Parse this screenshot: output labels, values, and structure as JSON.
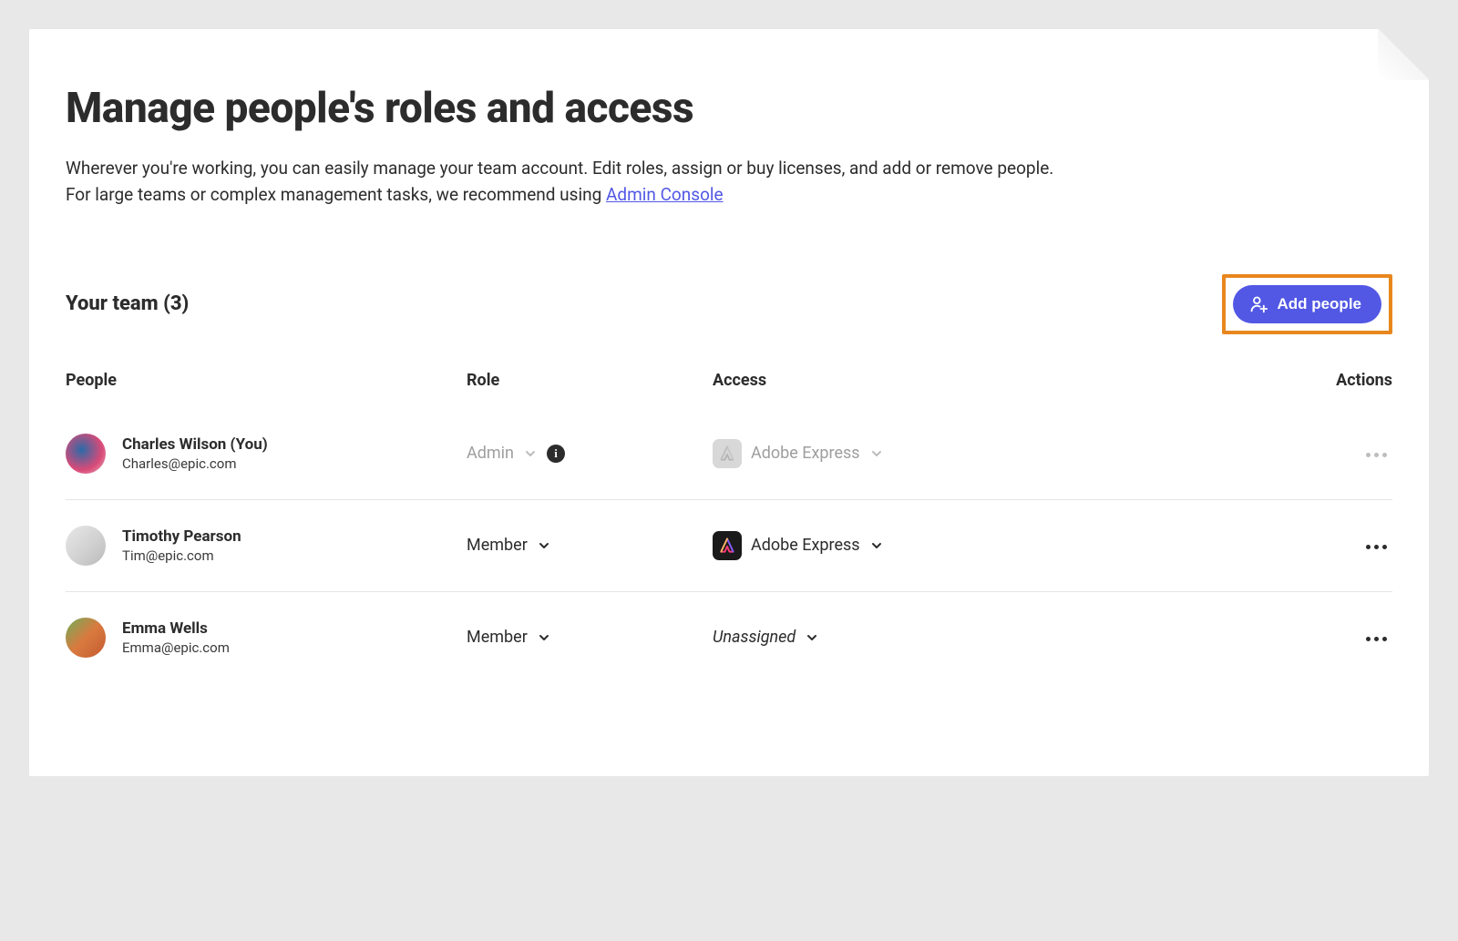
{
  "header": {
    "title": "Manage people's roles and access",
    "subtitle_1": "Wherever you're working, you can easily manage your team account. Edit roles, assign or buy licenses, and add or remove people.",
    "subtitle_2": "For large teams or complex management tasks, we recommend using ",
    "admin_console_link": "Admin Console"
  },
  "team": {
    "title": "Your team (3)",
    "add_people_label": "Add people"
  },
  "columns": {
    "people": "People",
    "role": "Role",
    "access": "Access",
    "actions": "Actions"
  },
  "rows": [
    {
      "name": "Charles Wilson (You)",
      "email": "Charles@epic.com",
      "role": "Admin",
      "role_disabled": true,
      "show_info": true,
      "access": "Adobe Express",
      "access_disabled": true,
      "access_unassigned": false,
      "actions_disabled": true,
      "avatar_class": "av-1"
    },
    {
      "name": "Timothy Pearson",
      "email": "Tim@epic.com",
      "role": "Member",
      "role_disabled": false,
      "show_info": false,
      "access": "Adobe Express",
      "access_disabled": false,
      "access_unassigned": false,
      "actions_disabled": false,
      "avatar_class": "av-2"
    },
    {
      "name": "Emma Wells",
      "email": "Emma@epic.com",
      "role": "Member",
      "role_disabled": false,
      "show_info": false,
      "access": "Unassigned",
      "access_disabled": false,
      "access_unassigned": true,
      "actions_disabled": false,
      "avatar_class": "av-3"
    }
  ]
}
